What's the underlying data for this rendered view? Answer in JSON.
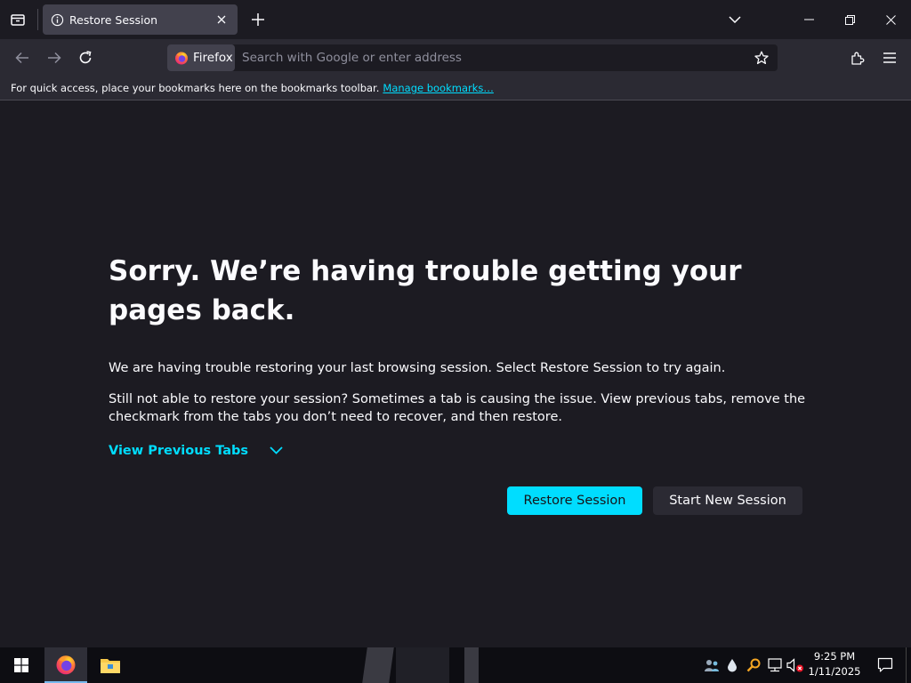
{
  "tab": {
    "title": "Restore Session"
  },
  "urlbar": {
    "identity_label": "Firefox",
    "placeholder": "Search with Google or enter address"
  },
  "bookmarks_bar": {
    "message": "For quick access, place your bookmarks here on the bookmarks toolbar.",
    "manage_link": "Manage bookmarks…"
  },
  "page": {
    "heading": "Sorry. We’re having trouble getting your pages back.",
    "paragraph_1": "We are having trouble restoring your last browsing session. Select Restore Session to try again.",
    "paragraph_2": "Still not able to restore your session? Sometimes a tab is causing the issue. View previous tabs, remove the checkmark from the tabs you don’t need to recover, and then restore.",
    "view_previous_tabs": "View Previous Tabs",
    "restore_button": "Restore Session",
    "new_session_button": "Start New Session"
  },
  "taskbar": {
    "time": "9:25 PM",
    "date": "1/11/2025"
  },
  "icons": {
    "tab_manager": "tab-manager-icon",
    "tab_info": "info-icon",
    "tab_close": "close-icon",
    "new_tab": "plus-icon",
    "list_all_tabs": "chevron-down-icon",
    "minimize": "minimize-icon",
    "restore_window": "restore-window-icon",
    "close_window": "close-window-icon",
    "back": "back-arrow-icon",
    "forward": "forward-arrow-icon",
    "reload": "reload-icon",
    "firefox_logo": "firefox-logo-icon",
    "bookmark_star": "star-icon",
    "extensions": "puzzle-icon",
    "app_menu": "hamburger-menu-icon",
    "start": "windows-start-icon",
    "file_explorer": "folder-icon",
    "notifications": "notification-icon"
  },
  "colors": {
    "accent": "#00ddff",
    "background": "#1c1b22",
    "toolbar": "#2b2a33",
    "tab_selected": "#42414d",
    "text": "#fbfbfe",
    "secondary_button": "#2b2a33"
  }
}
